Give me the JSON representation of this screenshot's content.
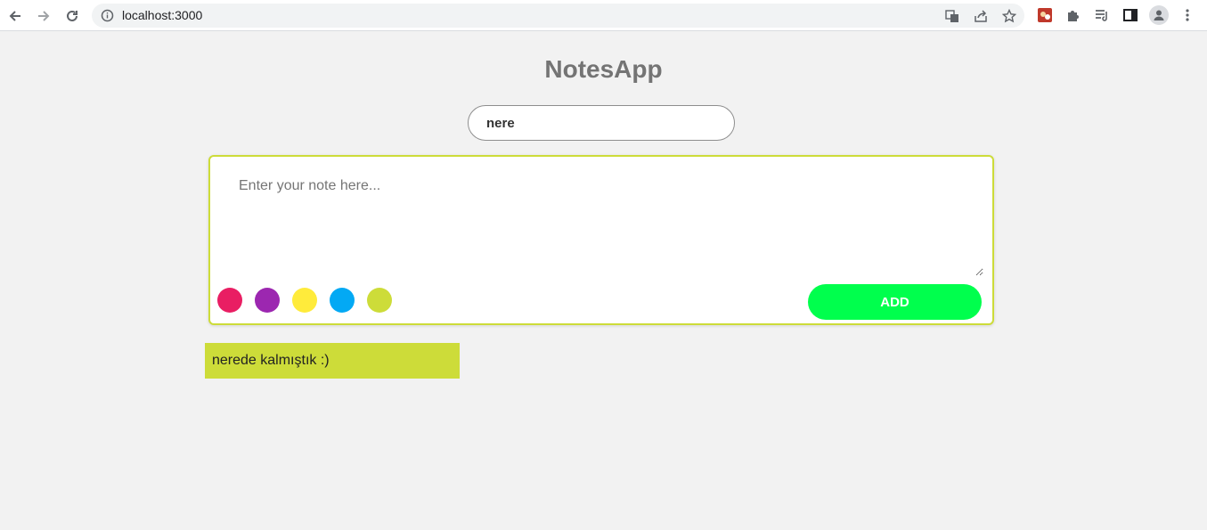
{
  "browser": {
    "url": "localhost:3000",
    "icons": [
      "back-icon",
      "forward-icon",
      "reload-icon",
      "site-info-icon",
      "translate-icon",
      "share-icon",
      "bookmark-star-icon",
      "extension-icon",
      "puzzle-icon",
      "reading-list-icon",
      "side-panel-icon",
      "profile-icon",
      "menu-icon"
    ]
  },
  "app": {
    "title": "NotesApp",
    "search": {
      "value": "nere"
    },
    "composer": {
      "placeholder": "Enter your note here...",
      "colors": [
        "#e91e63",
        "#9c27b0",
        "#ffeb3b",
        "#03a9f4",
        "#cddc39"
      ],
      "add_label": "ADD"
    },
    "notes": [
      {
        "text": "nerede kalmıştık :)",
        "color": "#cddc39"
      }
    ]
  }
}
